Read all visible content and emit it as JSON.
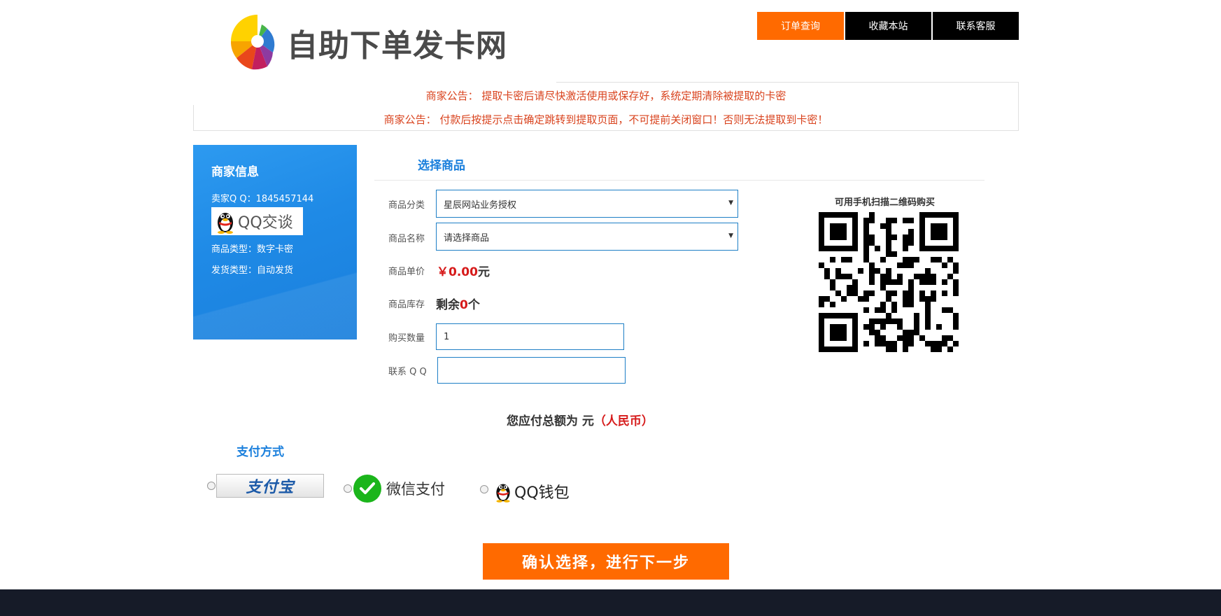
{
  "header": {
    "site_title": "自助下单发卡网",
    "nav": {
      "order_query": "订单查询",
      "bookmark": "收藏本站",
      "contact": "联系客服"
    }
  },
  "notices": [
    "商家公告： 提取卡密后请尽快激活使用或保存好，系统定期清除被提取的卡密",
    "商家公告： 付款后按提示点击确定跳转到提取页面，不可提前关闭窗口！否则无法提取到卡密！"
  ],
  "merchant": {
    "title": "商家信息",
    "qq": "卖家Q Q：1845457144",
    "qq_chat_label": "QQ交谈",
    "product_type": "商品类型：数字卡密",
    "delivery_type": "发货类型：自动发货"
  },
  "form": {
    "section_title": "选择商品",
    "category_label": "商品分类",
    "category_value": "星辰网站业务授权",
    "name_label": "商品名称",
    "name_value": "请选择商品",
    "price_label": "商品单价",
    "price_value": "￥0.00",
    "price_unit": "元",
    "stock_label": "商品库存",
    "stock_prefix": "剩余",
    "stock_count": "0",
    "stock_suffix": "个",
    "qty_label": "购买数量",
    "qty_value": "1",
    "qq_label": "联系 Q Q",
    "qq_value": ""
  },
  "qr": {
    "caption": "可用手机扫描二维码购买"
  },
  "total": {
    "prefix": "您应付总额为 元",
    "currency": "（人民币）"
  },
  "payment": {
    "title": "支付方式",
    "alipay": "支付宝",
    "wechat": "微信支付",
    "qqwallet": "QQ钱包"
  },
  "submit_label": "确认选择，进行下一步",
  "colors": {
    "accent_orange": "#ff6a00",
    "primary_blue": "#1a7fdc",
    "alert_red": "#d61a1a",
    "footer_dark": "#161b28"
  }
}
